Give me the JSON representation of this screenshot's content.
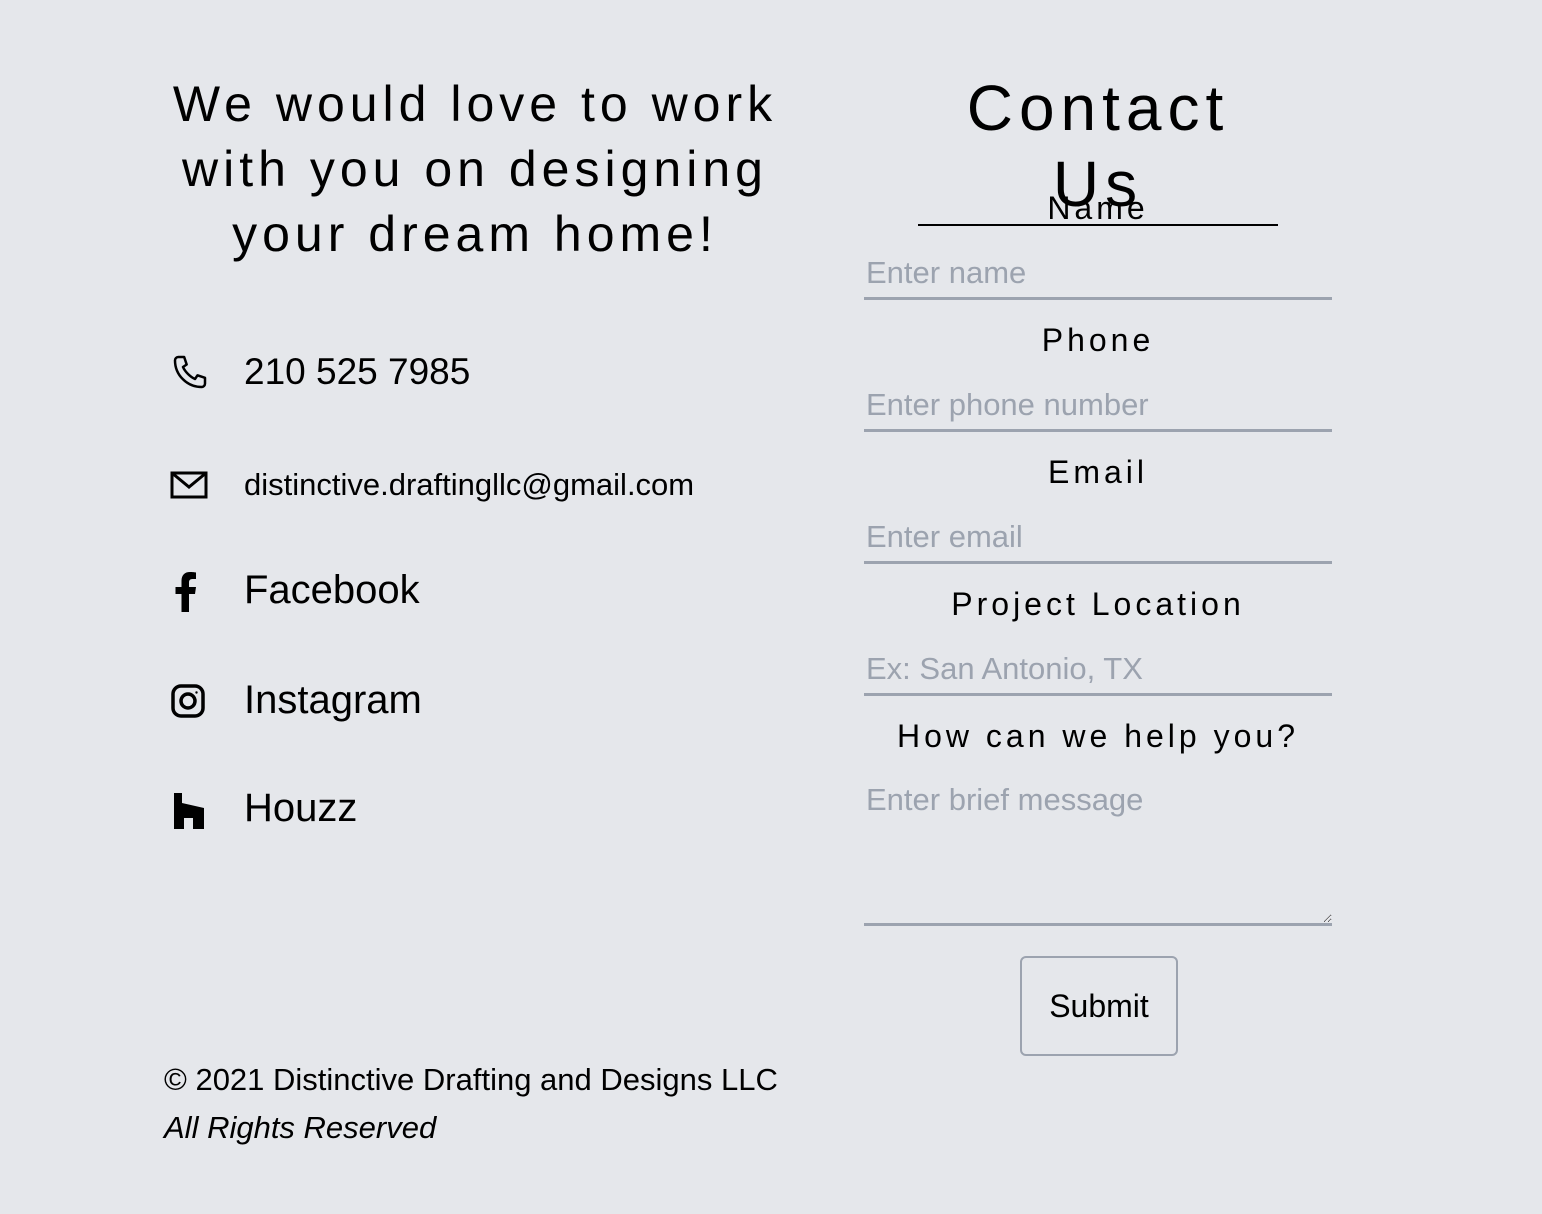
{
  "intro": {
    "tagline": "We would love to work with you on designing your dream home!"
  },
  "contact": {
    "phone": {
      "icon": "phone-icon",
      "text": "210 525 7985"
    },
    "email": {
      "icon": "mail-icon",
      "text": "distinctive.draftingllc@gmail.com"
    },
    "facebook": {
      "icon": "facebook-icon",
      "text": "Facebook"
    },
    "instagram": {
      "icon": "instagram-icon",
      "text": "Instagram"
    },
    "houzz": {
      "icon": "houzz-icon",
      "text": "Houzz"
    }
  },
  "footer": {
    "copyright": "© 2021 Distinctive Drafting and Designs LLC",
    "rights": "All Rights Reserved"
  },
  "form": {
    "title": "Contact Us",
    "fields": {
      "name": {
        "label": "Name",
        "placeholder": "Enter name",
        "value": ""
      },
      "phone": {
        "label": "Phone",
        "placeholder": "Enter phone number",
        "value": ""
      },
      "email": {
        "label": "Email",
        "placeholder": "Enter email",
        "value": ""
      },
      "location": {
        "label": "Project Location",
        "placeholder": "Ex: San Antonio, TX",
        "value": ""
      },
      "message": {
        "label": "How can we help you?",
        "placeholder": "Enter brief message",
        "value": ""
      }
    },
    "submit_label": "Submit"
  },
  "colors": {
    "background": "#e5e7eb",
    "text": "#000000",
    "placeholder": "#9ca3af",
    "input_border": "#9ca3af"
  }
}
